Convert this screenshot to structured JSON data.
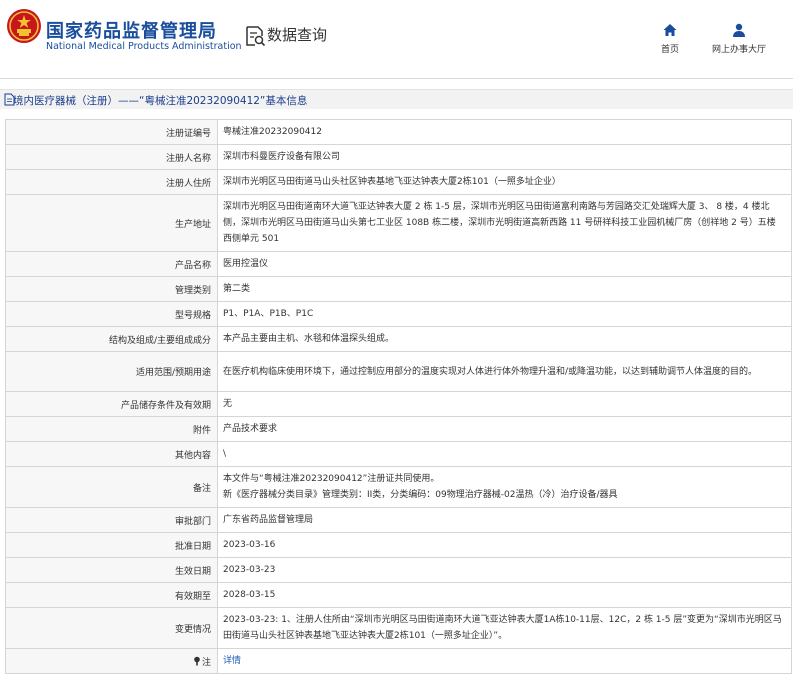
{
  "header": {
    "logo_cn": "国家药品监督管理局",
    "logo_en": "National Medical Products Administration",
    "search_label": "数据查询",
    "nav": [
      {
        "label": "首页",
        "icon": "home-icon"
      },
      {
        "label": "网上办事大厅",
        "icon": "user-icon"
      }
    ]
  },
  "title": "境内医疗器械（注册）——“粤械注准20232090412”基本信息",
  "fields": [
    {
      "label": "注册证编号",
      "value": "粤械注准20232090412"
    },
    {
      "label": "注册人名称",
      "value": "深圳市科曼医疗设备有限公司"
    },
    {
      "label": "注册人住所",
      "value": "深圳市光明区马田街道马山头社区钟表基地飞亚达钟表大厦2栋101（一照多址企业）"
    },
    {
      "label": "生产地址",
      "value": "深圳市光明区马田街道南环大道飞亚达钟表大厦 2 栋 1-5 层，深圳市光明区马田街道富利南路与芳园路交汇处瑞辉大厦 3、 8 楼，4 楼北侧，深圳市光明区马田街道马山头第七工业区 108B 栋二楼，深圳市光明街道高新西路 11 号研祥科技工业园机械厂房（创祥地 2 号）五楼西侧单元 501"
    },
    {
      "label": "产品名称",
      "value": "医用控温仪"
    },
    {
      "label": "管理类别",
      "value": "第二类"
    },
    {
      "label": "型号规格",
      "value": "P1、P1A、P1B、P1C"
    },
    {
      "label": "结构及组成/主要组成成分",
      "value": "本产品主要由主机、水毯和体温探头组成。"
    },
    {
      "label": "适用范围/预期用途",
      "value": "在医疗机构临床使用环境下，通过控制应用部分的温度实现对人体进行体外物理升温和/或降温功能，以达到辅助调节人体温度的目的。"
    },
    {
      "label": "产品储存条件及有效期",
      "value": "无"
    },
    {
      "label": "附件",
      "value": "产品技术要求"
    },
    {
      "label": "其他内容",
      "value": "\\"
    },
    {
      "label": "备注",
      "lines": [
        "本文件与“粤械注准20232090412”注册证共同使用。",
        "新《医疗器械分类目录》管理类别：II类，分类编码：09物理治疗器械-02温热（冷）治疗设备/器具"
      ]
    },
    {
      "label": "审批部门",
      "value": "广东省药品监督管理局"
    },
    {
      "label": "批准日期",
      "value": "2023-03-16"
    },
    {
      "label": "生效日期",
      "value": "2023-03-23"
    },
    {
      "label": "有效期至",
      "value": "2028-03-15"
    },
    {
      "label": "变更情况",
      "value": "2023-03-23: 1、注册人住所由“深圳市光明区马田街道南环大道飞亚达钟表大厦1A栋10-11层、12C，2 栋 1-5 层”变更为“深圳市光明区马田街道马山头社区钟表基地飞亚达钟表大厦2栋101（一照多址企业）”。"
    },
    {
      "label": "注",
      "icon": "note-icon",
      "value": "详情",
      "link": true
    }
  ],
  "colors": {
    "brand": "#1a4e9c",
    "link": "#1a5db3",
    "label_bg": "#f7f7f7",
    "border": "#d5d5d5"
  }
}
